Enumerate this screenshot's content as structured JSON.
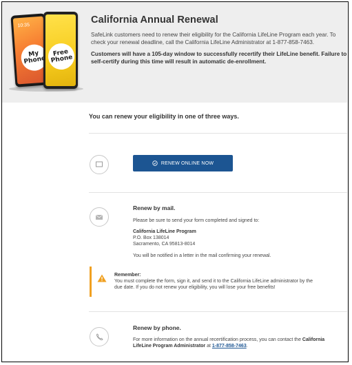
{
  "hero": {
    "title": "California Annual Renewal",
    "paragraph": "SafeLink customers need to renew their eligibility for the California LifeLine Program each year. To check your renewal deadline, call the California LifeLine Administrator at 1-877-858-7463.",
    "bold_paragraph": "Customers will have a 105-day window to successfully recertify their LifeLine benefit. Failure to self-certify during this time will result in automatic de-enrollment.",
    "phone_badge_left": "My Phone",
    "phone_badge_right": "Free Phone",
    "phone_time": "10:35"
  },
  "intro": "You can renew your eligibility in one of three ways.",
  "online": {
    "button_label": "RENEW ONLINE NOW",
    "icon": "laptop-icon"
  },
  "mail": {
    "icon": "envelope-icon",
    "title": "Renew by mail.",
    "instruction": "Please be sure to send your form completed and signed to:",
    "address": {
      "name": "California LifeLine Program",
      "line1": "P.O. Box 138014",
      "line2": "Sacramento, CA 95813-8014"
    },
    "notice": "You will be notified in a letter in the mail confirming your renewal."
  },
  "remember": {
    "icon": "warning-icon",
    "title": "Remember:",
    "text": "You must complete the form, sign it, and send it to the California LifeLine administrator by the due date. If you do not renew your eligibility, you will lose your free benefits!"
  },
  "phone": {
    "icon": "phone-icon",
    "title": "Renew by phone.",
    "text_before": "For more information on the annual recertification process, you can contact the ",
    "bold_name": "California LifeLine Program Administrator",
    "text_mid": " at ",
    "number": "1-877-858-7463",
    "text_after": "."
  },
  "colors": {
    "button": "#1c5592",
    "warning": "#f0a020",
    "hero_bg": "#eeeeee"
  }
}
